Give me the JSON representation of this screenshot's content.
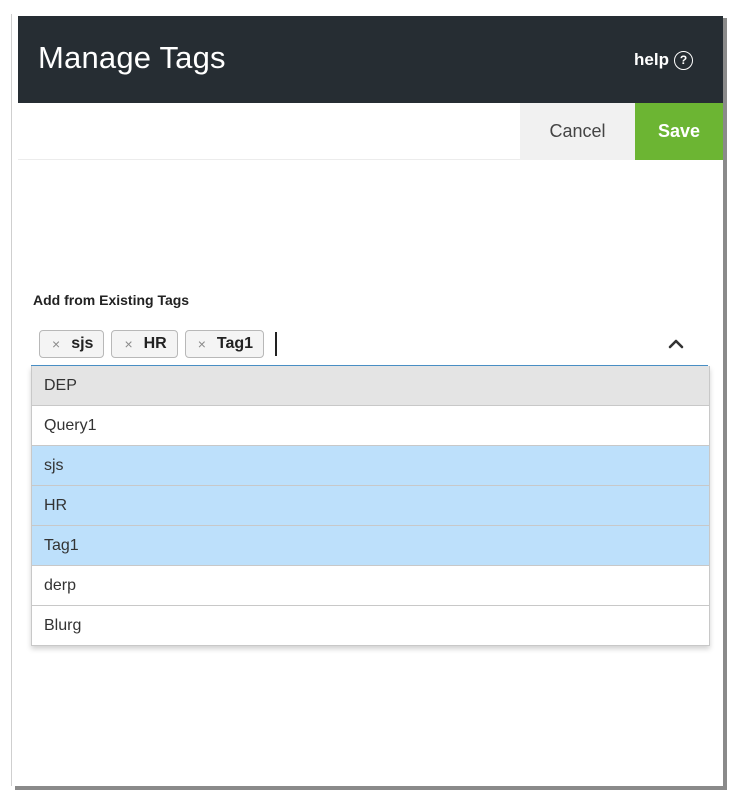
{
  "header": {
    "title": "Manage Tags",
    "help_label": "help",
    "help_icon": "?"
  },
  "toolbar": {
    "cancel_label": "Cancel",
    "save_label": "Save"
  },
  "tag_picker": {
    "label": "Add from Existing Tags",
    "input_value": "",
    "selected_tags": [
      {
        "label": "sjs",
        "remove": "×"
      },
      {
        "label": "HR",
        "remove": "×"
      },
      {
        "label": "Tag1",
        "remove": "×"
      }
    ],
    "options": [
      {
        "label": "DEP",
        "state": "hover"
      },
      {
        "label": "Query1",
        "state": "normal"
      },
      {
        "label": "sjs",
        "state": "selected"
      },
      {
        "label": "HR",
        "state": "selected"
      },
      {
        "label": "Tag1",
        "state": "selected"
      },
      {
        "label": "derp",
        "state": "normal"
      },
      {
        "label": "Blurg",
        "state": "normal"
      }
    ]
  },
  "colors": {
    "header_bg": "#262d33",
    "save_green": "#6cb533",
    "selected_blue": "#bde0fb",
    "hover_gray": "#e4e4e4",
    "focus_underline": "#4a90c8"
  },
  "icons": {
    "help": "help-circle-icon",
    "chip_remove": "close-icon",
    "collapse": "chevron-up-icon"
  }
}
